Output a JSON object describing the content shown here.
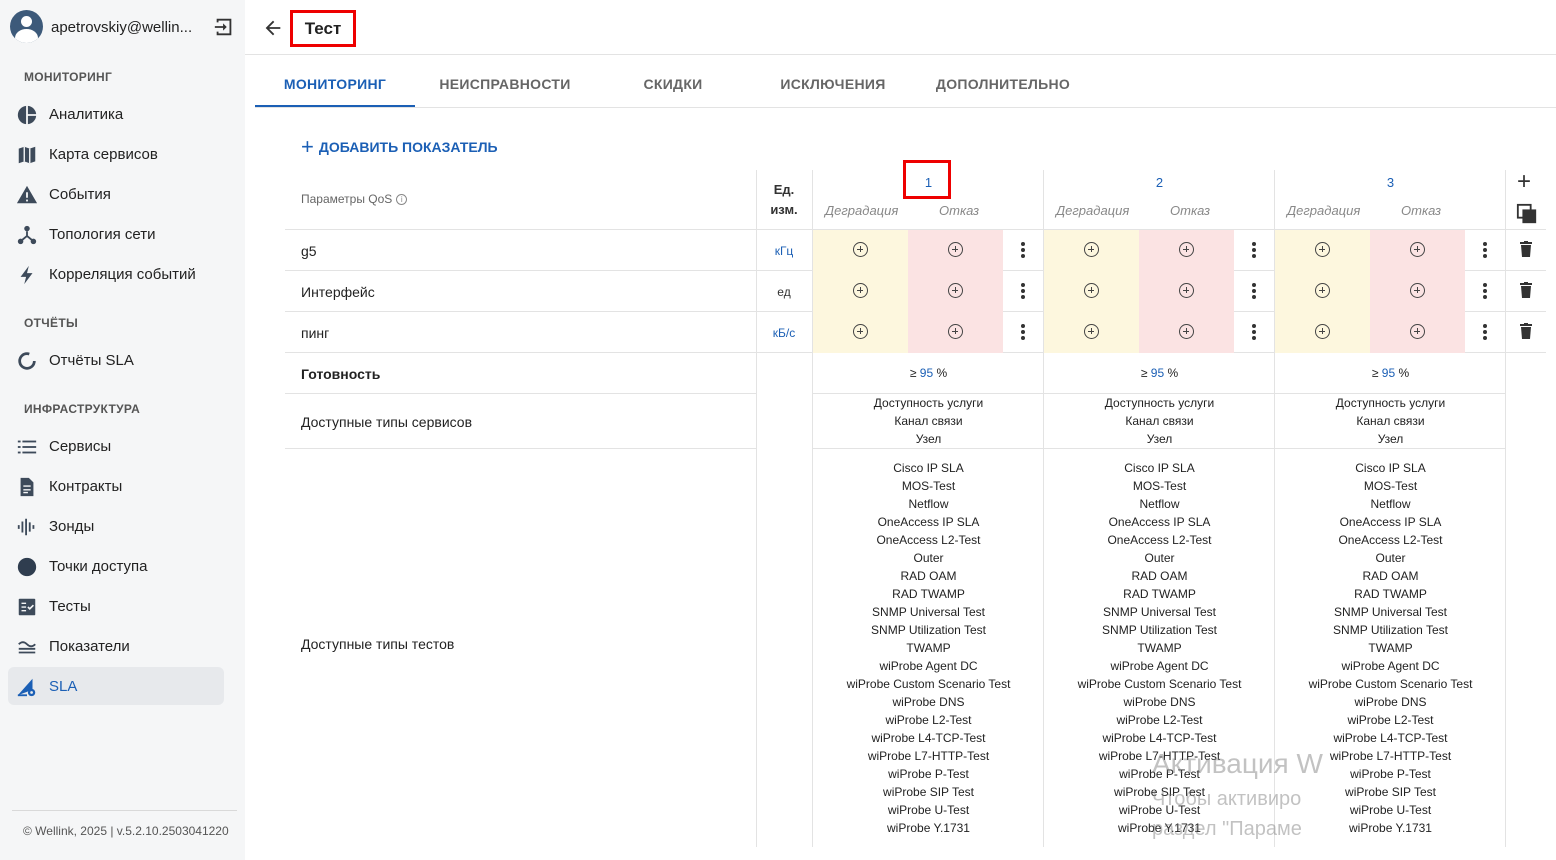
{
  "sidebar": {
    "user": "apetrovskiy@wellin...",
    "sections": [
      {
        "title": "МОНИТОРИНГ"
      },
      {
        "title": "ОТЧЁТЫ"
      },
      {
        "title": "ИНФРАСТРУКТУРА"
      }
    ],
    "items": [
      {
        "label": "Аналитика",
        "icon": "pie-chart-icon"
      },
      {
        "label": "Карта сервисов",
        "icon": "map-icon"
      },
      {
        "label": "События",
        "icon": "warning-icon"
      },
      {
        "label": "Топология сети",
        "icon": "topology-icon"
      },
      {
        "label": "Корреляция событий",
        "icon": "lightning-icon"
      },
      {
        "label": "Отчёты SLA",
        "icon": "circle-progress-icon"
      },
      {
        "label": "Сервисы",
        "icon": "list-icon"
      },
      {
        "label": "Контракты",
        "icon": "document-icon"
      },
      {
        "label": "Зонды",
        "icon": "signal-icon"
      },
      {
        "label": "Точки доступа",
        "icon": "dot-icon"
      },
      {
        "label": "Тесты",
        "icon": "checklist-icon"
      },
      {
        "label": "Показатели",
        "icon": "metrics-icon"
      },
      {
        "label": "SLA",
        "icon": "sla-gear-icon",
        "active": true
      }
    ],
    "footer": "© Wellink, 2025 | v.5.2.10.2503041220"
  },
  "header": {
    "title": "Тест"
  },
  "tabs": [
    {
      "label": "МОНИТОРИНГ",
      "active": true
    },
    {
      "label": "НЕИСПРАВНОСТИ"
    },
    {
      "label": "СКИДКИ"
    },
    {
      "label": "ИСКЛЮЧЕНИЯ"
    },
    {
      "label": "ДОПОЛНИТЕЛЬНО"
    }
  ],
  "add_metric": "ДОБАВИТЬ ПОКАЗАТЕЛЬ",
  "table": {
    "qos_header": "Параметры QoS",
    "unit_header_line1": "Ед.",
    "unit_header_line2": "изм.",
    "degradation_label": "Деградация",
    "failure_label": "Отказ",
    "columns": [
      "1",
      "2",
      "3"
    ],
    "rows": [
      {
        "name": "g5",
        "unit": "кГц"
      },
      {
        "name": "Интерфейс",
        "unit": "ед"
      },
      {
        "name": "пинг",
        "unit": "кБ/с"
      }
    ],
    "availability_label": "Готовность",
    "availability_prefix": "≥",
    "availability_value": "95",
    "availability_unit": "%",
    "service_types_label": "Доступные типы сервисов",
    "service_types": [
      "Доступность услуги",
      "Канал связи",
      "Узел"
    ],
    "test_types_label": "Доступные типы тестов",
    "test_types": [
      "Cisco IP SLA",
      "MOS-Test",
      "Netflow",
      "OneAccess IP SLA",
      "OneAccess L2-Test",
      "Outer",
      "RAD OAM",
      "RAD TWAMP",
      "SNMP Universal Test",
      "SNMP Utilization Test",
      "TWAMP",
      "wiProbe Agent DC",
      "wiProbe Custom Scenario Test",
      "wiProbe DNS",
      "wiProbe L2-Test",
      "wiProbe L4-TCP-Test",
      "wiProbe L7-HTTP-Test",
      "wiProbe P-Test",
      "wiProbe SIP Test",
      "wiProbe U-Test",
      "wiProbe Y.1731"
    ]
  },
  "watermark": {
    "line1": "Активация W",
    "line2": "Чтобы активиро",
    "line3": "раздел \"Параме"
  }
}
